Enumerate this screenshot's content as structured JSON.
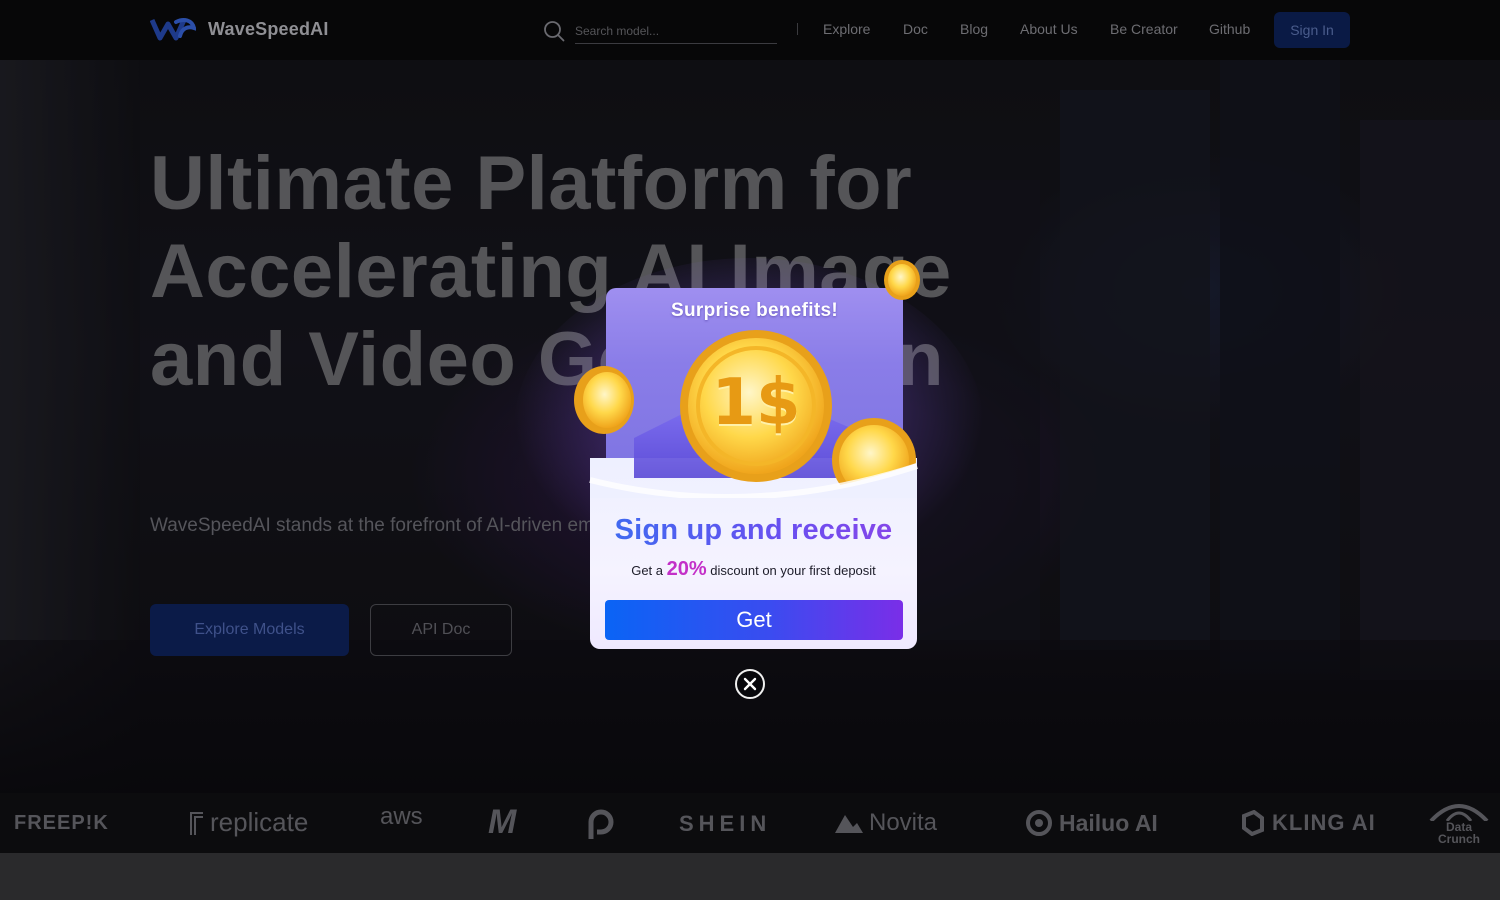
{
  "header": {
    "brand": "WaveSpeedAI",
    "search_placeholder": "Search model...",
    "nav": [
      "Explore",
      "Doc",
      "Blog",
      "About Us",
      "Be Creator",
      "Github"
    ],
    "signin_label": "Sign In"
  },
  "hero": {
    "title": "Ultimate Platform for Accelerating AI Image and Video Generation",
    "description": "WaveSpeedAI stands at the forefront of AI-driven empowering creators with cutting-edge technology",
    "primary_button": "Explore Models",
    "secondary_button": "API Doc"
  },
  "partners": [
    "FREEP!K",
    "replicate",
    "aws",
    "M",
    "P",
    "SHEIN",
    "Novita",
    "Hailuo AI",
    "KLING AI",
    "Data Crunch"
  ],
  "popup": {
    "heading": "Surprise benefits!",
    "coin_label": "1$",
    "title": "Sign up and receive",
    "sub_prefix": "Get a",
    "sub_percent": "20%",
    "sub_suffix": "discount on your first deposit",
    "get_label": "Get"
  },
  "colors": {
    "accent_blue": "#0a64f5",
    "accent_purple": "#7a2ee8",
    "highlight_pink": "#c330c8"
  }
}
